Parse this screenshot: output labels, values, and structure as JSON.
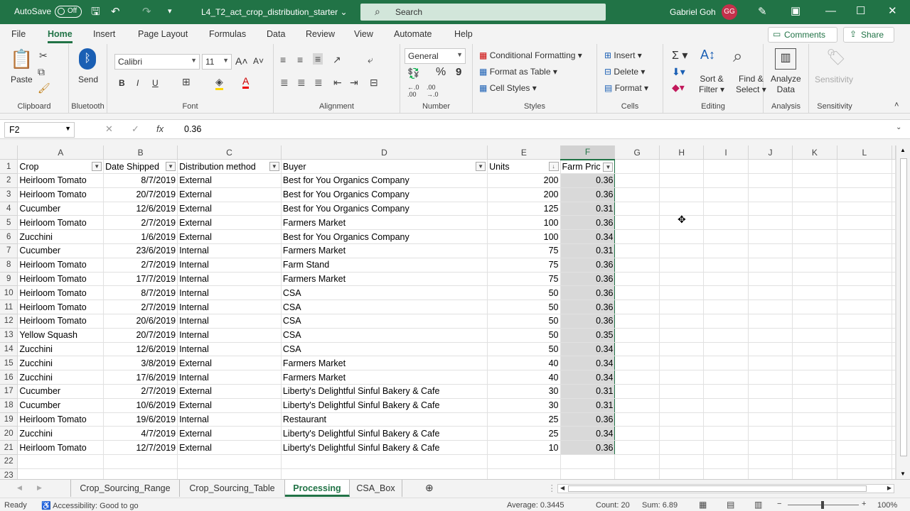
{
  "titlebar": {
    "autosave_label": "AutoSave",
    "autosave_state": "Off",
    "filename": "L4_T2_act_crop_distribution_starter",
    "search_placeholder": "Search",
    "user_name": "Gabriel Goh",
    "user_initials": "GG",
    "accent_color": "#217346"
  },
  "menu": {
    "items": [
      "File",
      "Home",
      "Insert",
      "Page Layout",
      "Formulas",
      "Data",
      "Review",
      "View",
      "Automate",
      "Help"
    ],
    "active": "Home",
    "comments_label": "Comments",
    "share_label": "Share"
  },
  "ribbon": {
    "clipboard": {
      "paste": "Paste",
      "group": "Clipboard"
    },
    "bluetooth": {
      "send": "Send",
      "group": "Bluetooth"
    },
    "font": {
      "name": "Calibri",
      "size": "11",
      "bold": "B",
      "italic": "I",
      "underline": "U",
      "group": "Font"
    },
    "alignment": {
      "group": "Alignment"
    },
    "number": {
      "format": "General",
      "group": "Number"
    },
    "styles": {
      "conditional": "Conditional Formatting",
      "format_table": "Format as Table",
      "cell_styles": "Cell Styles",
      "group": "Styles"
    },
    "cells": {
      "insert": "Insert",
      "delete": "Delete",
      "format": "Format",
      "group": "Cells"
    },
    "editing": {
      "sort_filter_1": "Sort &",
      "sort_filter_2": "Filter",
      "find_select_1": "Find &",
      "find_select_2": "Select",
      "group": "Editing"
    },
    "analysis": {
      "analyze_1": "Analyze",
      "analyze_2": "Data",
      "group": "Analysis"
    },
    "sensitivity": {
      "label": "Sensitivity",
      "group": "Sensitivity"
    }
  },
  "formula_bar": {
    "name_box": "F2",
    "value": "0.36"
  },
  "grid": {
    "columns": [
      "A",
      "B",
      "C",
      "D",
      "E",
      "F",
      "G",
      "H",
      "I",
      "J",
      "K",
      "L"
    ],
    "selected_column": "F",
    "headers": [
      "Crop",
      "Date Shipped",
      "Distribution method",
      "Buyer",
      "Units",
      "Farm Pric"
    ],
    "rows": [
      [
        "Heirloom Tomato",
        "8/7/2019",
        "External",
        "Best for You Organics Company",
        "200",
        "0.36"
      ],
      [
        "Heirloom Tomato",
        "20/7/2019",
        "External",
        "Best for You Organics Company",
        "200",
        "0.36"
      ],
      [
        "Cucumber",
        "12/6/2019",
        "External",
        "Best for You Organics Company",
        "125",
        "0.31"
      ],
      [
        "Heirloom Tomato",
        "2/7/2019",
        "External",
        "Farmers Market",
        "100",
        "0.36"
      ],
      [
        "Zucchini",
        "1/6/2019",
        "External",
        "Best for You Organics Company",
        "100",
        "0.34"
      ],
      [
        "Cucumber",
        "23/6/2019",
        "Internal",
        "Farmers Market",
        "75",
        "0.31"
      ],
      [
        "Heirloom Tomato",
        "2/7/2019",
        "Internal",
        "Farm Stand",
        "75",
        "0.36"
      ],
      [
        "Heirloom Tomato",
        "17/7/2019",
        "Internal",
        "Farmers Market",
        "75",
        "0.36"
      ],
      [
        "Heirloom Tomato",
        "8/7/2019",
        "Internal",
        "CSA",
        "50",
        "0.36"
      ],
      [
        "Heirloom Tomato",
        "2/7/2019",
        "Internal",
        "CSA",
        "50",
        "0.36"
      ],
      [
        "Heirloom Tomato",
        "20/6/2019",
        "Internal",
        "CSA",
        "50",
        "0.36"
      ],
      [
        "Yellow Squash",
        "20/7/2019",
        "Internal",
        "CSA",
        "50",
        "0.35"
      ],
      [
        "Zucchini",
        "12/6/2019",
        "Internal",
        "CSA",
        "50",
        "0.34"
      ],
      [
        "Zucchini",
        "3/8/2019",
        "External",
        "Farmers Market",
        "40",
        "0.34"
      ],
      [
        "Zucchini",
        "17/6/2019",
        "Internal",
        "Farmers Market",
        "40",
        "0.34"
      ],
      [
        "Cucumber",
        "2/7/2019",
        "External",
        "Liberty's Delightful Sinful Bakery & Cafe",
        "30",
        "0.31"
      ],
      [
        "Cucumber",
        "10/6/2019",
        "External",
        "Liberty's Delightful Sinful Bakery & Cafe",
        "30",
        "0.31"
      ],
      [
        "Heirloom Tomato",
        "19/6/2019",
        "Internal",
        "Restaurant",
        "25",
        "0.36"
      ],
      [
        "Zucchini",
        "4/7/2019",
        "External",
        "Liberty's Delightful Sinful Bakery & Cafe",
        "25",
        "0.34"
      ],
      [
        "Heirloom Tomato",
        "12/7/2019",
        "External",
        "Liberty's Delightful Sinful Bakery & Cafe",
        "10",
        "0.36"
      ]
    ],
    "empty_rows": [
      "22",
      "23"
    ]
  },
  "sheets": {
    "tabs": [
      "Crop_Sourcing_Range",
      "Crop_Sourcing_Table",
      "Processing",
      "CSA_Box"
    ],
    "active": "Processing"
  },
  "status": {
    "ready": "Ready",
    "accessibility": "Accessibility: Good to go",
    "average": "Average: 0.3445",
    "count": "Count: 20",
    "sum": "Sum: 6.89",
    "zoom": "100%"
  }
}
